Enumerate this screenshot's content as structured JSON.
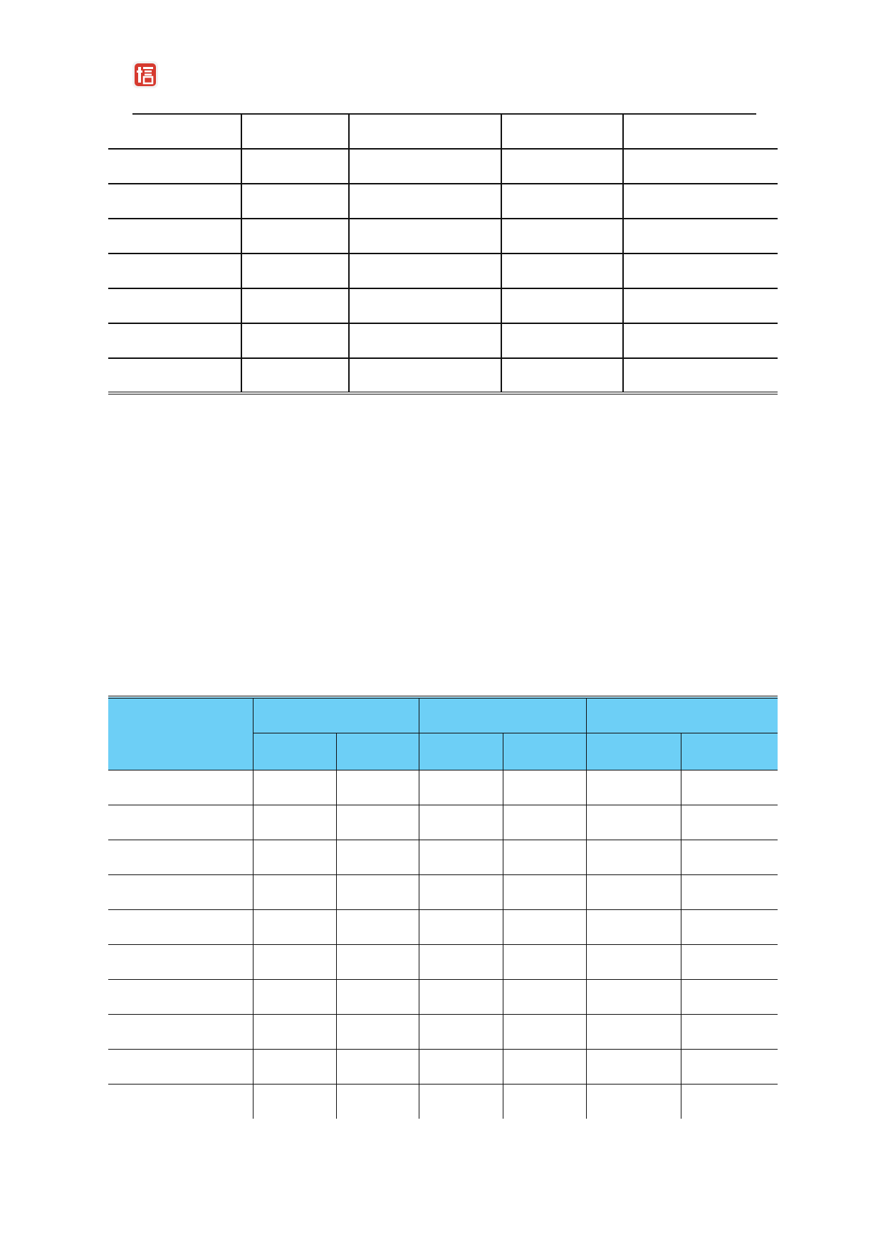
{
  "colors": {
    "logo_red": "#d63a2f",
    "header_fill": "#6dcff6",
    "rule": "#111111"
  },
  "logo": {
    "icon": "seal-logo-icon"
  },
  "table_1": {
    "rows": [
      [
        "",
        "",
        "",
        "",
        ""
      ],
      [
        "",
        "",
        "",
        "",
        ""
      ],
      [
        "",
        "",
        "",
        "",
        ""
      ],
      [
        "",
        "",
        "",
        "",
        ""
      ],
      [
        "",
        "",
        "",
        "",
        ""
      ],
      [
        "",
        "",
        "",
        "",
        ""
      ],
      [
        "",
        "",
        "",
        "",
        ""
      ],
      [
        "",
        "",
        "",
        "",
        ""
      ]
    ]
  },
  "table_2": {
    "header": {
      "stub": "",
      "groups": [
        "",
        "",
        ""
      ],
      "subheaders": [
        "",
        "",
        "",
        "",
        "",
        ""
      ]
    },
    "rows": [
      [
        "",
        "",
        "",
        "",
        "",
        "",
        ""
      ],
      [
        "",
        "",
        "",
        "",
        "",
        "",
        ""
      ],
      [
        "",
        "",
        "",
        "",
        "",
        "",
        ""
      ],
      [
        "",
        "",
        "",
        "",
        "",
        "",
        ""
      ],
      [
        "",
        "",
        "",
        "",
        "",
        "",
        ""
      ],
      [
        "",
        "",
        "",
        "",
        "",
        "",
        ""
      ],
      [
        "",
        "",
        "",
        "",
        "",
        "",
        ""
      ],
      [
        "",
        "",
        "",
        "",
        "",
        "",
        ""
      ],
      [
        "",
        "",
        "",
        "",
        "",
        "",
        ""
      ],
      [
        "",
        "",
        "",
        "",
        "",
        "",
        ""
      ]
    ]
  }
}
